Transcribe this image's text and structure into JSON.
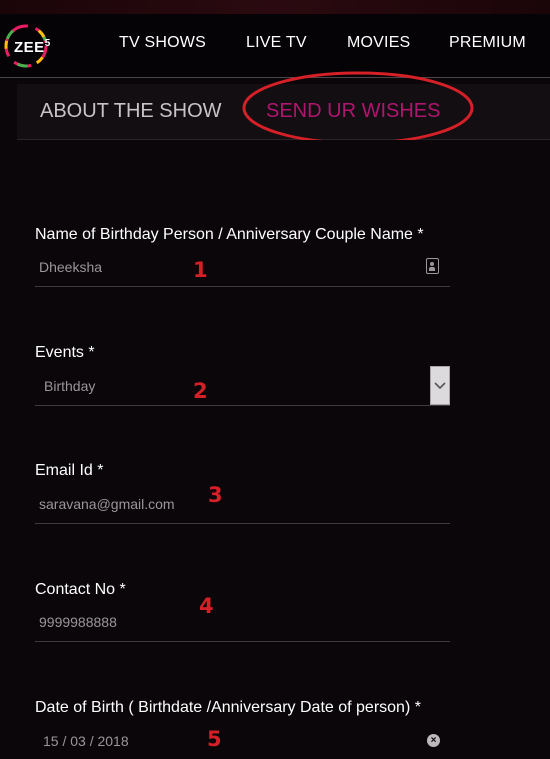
{
  "logo": {
    "text": "ZEE",
    "superscript": "5"
  },
  "nav": {
    "items": [
      {
        "label": "TV SHOWS"
      },
      {
        "label": "LIVE TV"
      },
      {
        "label": "MOVIES"
      },
      {
        "label": "PREMIUM"
      }
    ]
  },
  "tabs": {
    "about": "ABOUT THE SHOW",
    "wishes": "SEND UR WISHES",
    "active": "wishes"
  },
  "form": {
    "name": {
      "label": "Name of Birthday Person / Anniversary Couple Name *",
      "value": "Dheeksha"
    },
    "events": {
      "label": "Events *",
      "value": "Birthday"
    },
    "email": {
      "label": "Email Id *",
      "value": "saravana@gmail.com"
    },
    "contact": {
      "label": "Contact No *",
      "value": "9999988888"
    },
    "dob": {
      "label": "Date of Birth ( Birthdate /Anniversary Date of person) *",
      "value": "15 / 03 / 2018"
    }
  },
  "annotations": {
    "markers": [
      "1",
      "2",
      "3",
      "4",
      "5"
    ],
    "marker_color": "#d42026",
    "highlight_circle_color": "#d42026"
  },
  "colors": {
    "accent": "#b0166e",
    "background": "#0a0609",
    "tab_bar": "#120e12"
  }
}
